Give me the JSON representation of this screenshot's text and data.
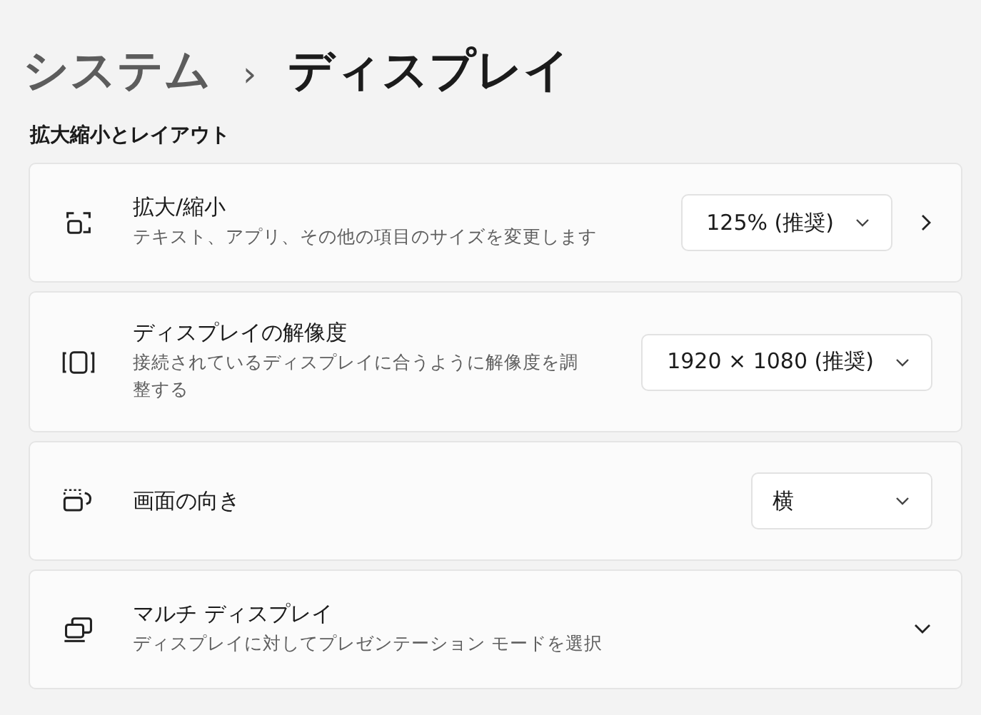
{
  "breadcrumb": {
    "parent": "システム",
    "separator": "›",
    "current": "ディスプレイ"
  },
  "section_title": "拡大縮小とレイアウト",
  "rows": [
    {
      "title": "拡大/縮小",
      "description": "テキスト、アプリ、その他の項目のサイズを変更します",
      "control": {
        "kind": "dropdown",
        "value": "125% (推奨)",
        "link": true
      }
    },
    {
      "title": "ディスプレイの解像度",
      "description": "接続されているディスプレイに合うように解像度を調整する",
      "control": {
        "kind": "dropdown",
        "value": "1920 × 1080 (推奨)",
        "link": false
      }
    },
    {
      "title": "画面の向き",
      "control": {
        "kind": "dropdown",
        "value": "横",
        "link": false
      }
    },
    {
      "title": "マルチ ディスプレイ",
      "description": "ディスプレイに対してプレゼンテーション モードを選択",
      "control": {
        "kind": "expand"
      }
    }
  ]
}
